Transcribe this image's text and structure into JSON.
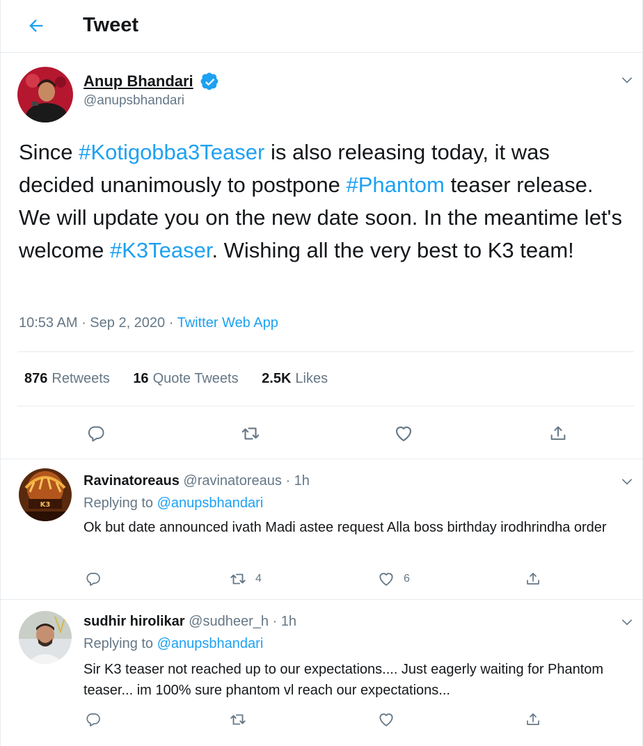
{
  "header": {
    "title": "Tweet"
  },
  "main_tweet": {
    "author_name": "Anup Bhandari",
    "author_handle": "@anupsbhandari",
    "text": [
      {
        "t": "Since ",
        "tag": false
      },
      {
        "t": "#Kotigobba3Teaser",
        "tag": true
      },
      {
        "t": " is also releasing today, it was decided unanimously to postpone ",
        "tag": false
      },
      {
        "t": "#Phantom",
        "tag": true
      },
      {
        "t": "  teaser release. We will update you on the new date soon. In the meantime let's welcome ",
        "tag": false
      },
      {
        "t": "#K3Teaser",
        "tag": true
      },
      {
        "t": ". Wishing all the very best to K3 team!",
        "tag": false
      }
    ],
    "time": "10:53 AM",
    "date": "Sep 2, 2020",
    "source": "Twitter Web App",
    "stats": {
      "retweets_num": "876",
      "retweets_label": "Retweets",
      "quotes_num": "16",
      "quotes_label": "Quote Tweets",
      "likes_num": "2.5K",
      "likes_label": "Likes"
    }
  },
  "replies": [
    {
      "name": "Ravinatoreaus",
      "handle": "@ravinatoreaus",
      "time": "1h",
      "replying_label": "Replying to",
      "replying_to": "@anupsbhandari",
      "text": "Ok but date announced ivath Madi astee request Alla boss birthday irodhrindha order",
      "retweets": "4",
      "likes": "6"
    },
    {
      "name": "sudhir hirolikar",
      "handle": "@sudheer_h",
      "time": "1h",
      "replying_label": "Replying to",
      "replying_to": "@anupsbhandari",
      "text": "Sir  K3 teaser not reached up to our expectations.... Just eagerly waiting for Phantom teaser... im 100% sure phantom vl reach our expectations...",
      "retweets": "",
      "likes": ""
    }
  ],
  "colors": {
    "accent": "#1da1f2",
    "secondary_text": "#657786",
    "border": "#e6ecf0"
  }
}
